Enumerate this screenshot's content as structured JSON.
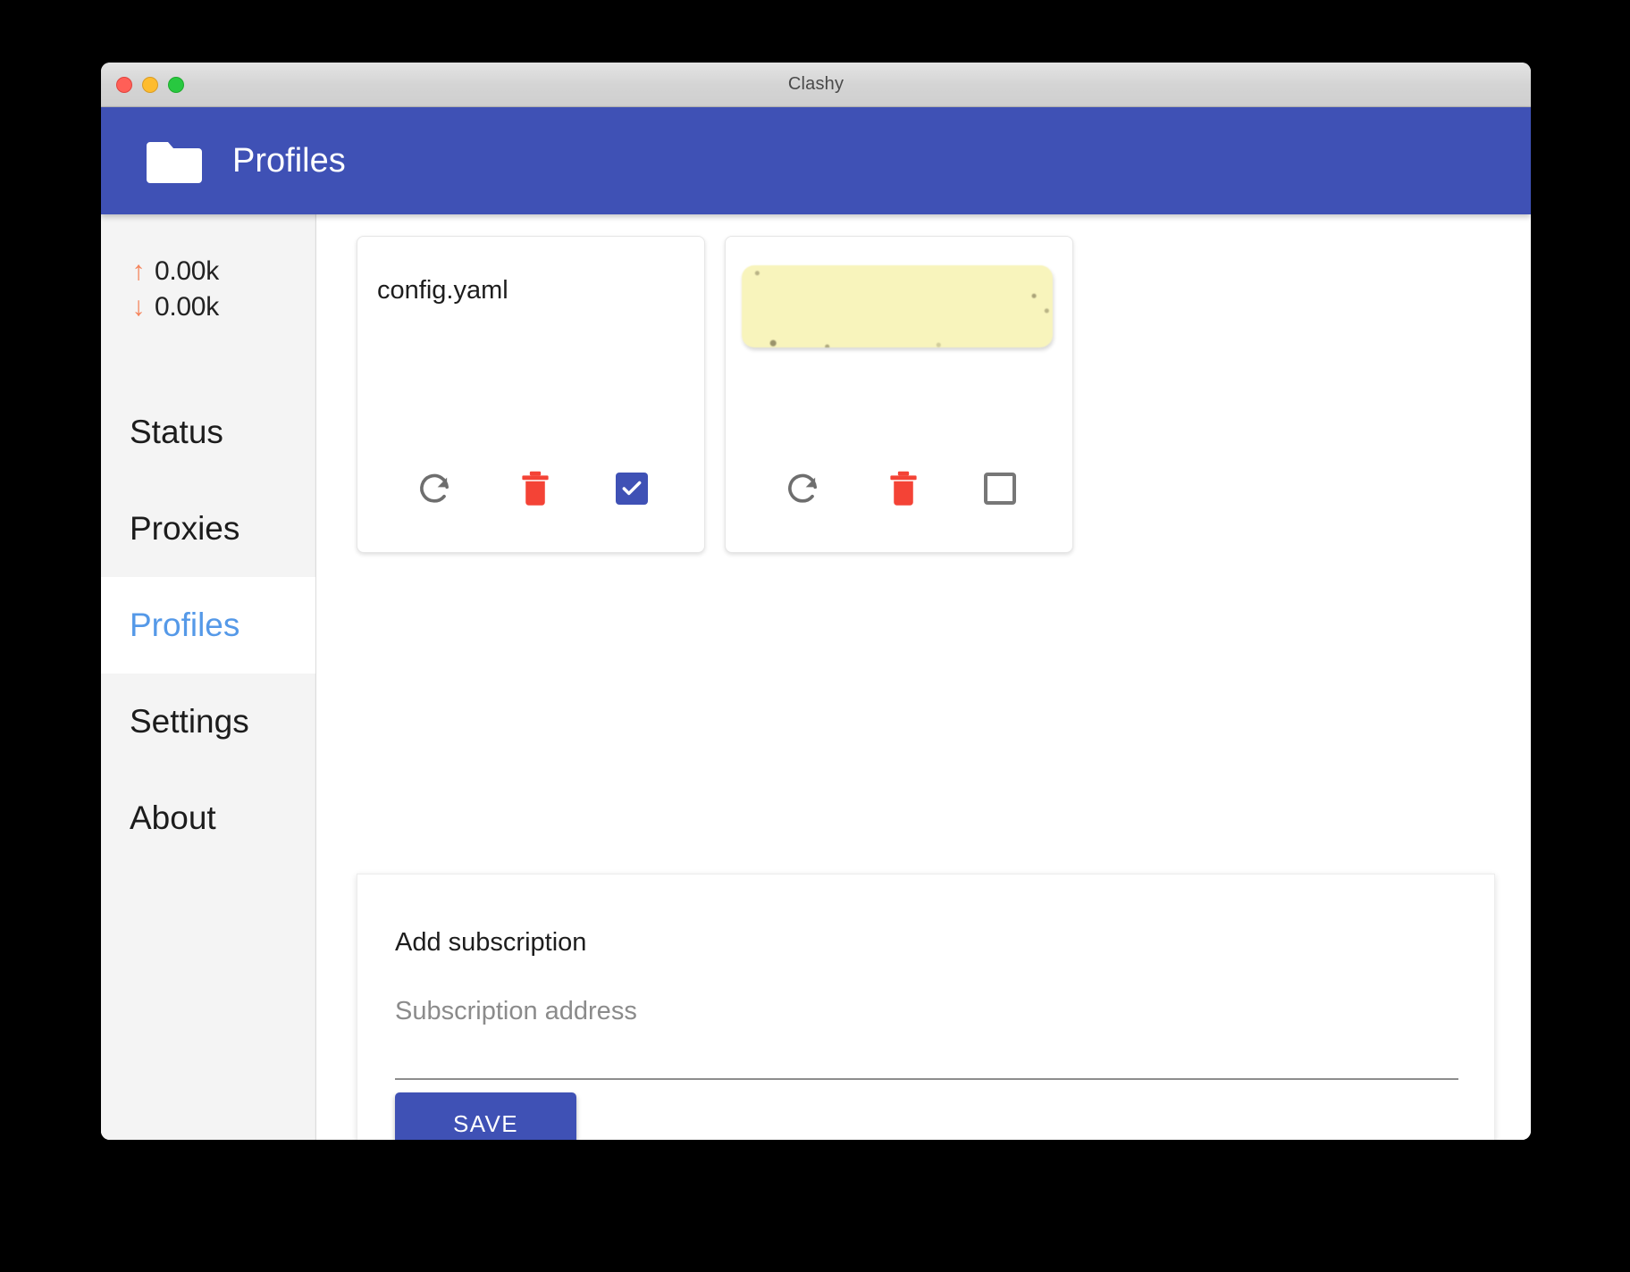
{
  "window": {
    "title": "Clashy",
    "traffic_lights": [
      "close",
      "minimize",
      "maximize"
    ]
  },
  "appbar": {
    "icon": "folder-icon",
    "title": "Profiles",
    "background": "#3f51b5"
  },
  "sidebar": {
    "upload": {
      "arrow": "↑",
      "value": "0.00k"
    },
    "download": {
      "arrow": "↓",
      "value": "0.00k"
    },
    "arrow_color": "#f5835a",
    "items": [
      {
        "label": "Status",
        "active": false
      },
      {
        "label": "Proxies",
        "active": false
      },
      {
        "label": "Profiles",
        "active": true
      },
      {
        "label": "Settings",
        "active": false
      },
      {
        "label": "About",
        "active": false
      }
    ],
    "active_color": "#5599e8"
  },
  "profiles": [
    {
      "name": "config.yaml",
      "redacted": false,
      "refresh_icon": "refresh-icon",
      "delete_icon": "trash-icon",
      "selected": true
    },
    {
      "name": "",
      "redacted": true,
      "refresh_icon": "refresh-icon",
      "delete_icon": "trash-icon",
      "selected": false
    }
  ],
  "subscription_form": {
    "heading": "Add subscription",
    "input_value": "",
    "input_placeholder": "Subscription address",
    "save_label": "SAVE",
    "save_color": "#3f51b5"
  }
}
